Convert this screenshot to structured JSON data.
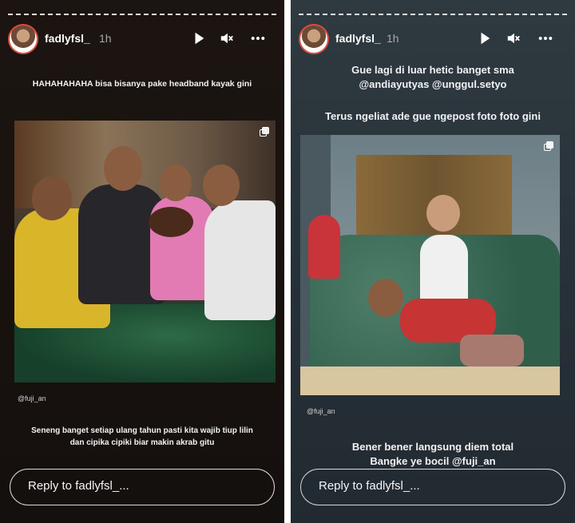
{
  "stories": [
    {
      "username": "fadlyfsl_",
      "time": "1h",
      "caption_top": "HAHAHAHAHA bisa bisanya pake headband kayak gini",
      "mention": "@fuji_an",
      "caption_bottom_1": "Seneng banget setiap ulang tahun pasti kita wajib tiup lilin",
      "caption_bottom_2": "dan cipika cipiki biar makin akrab gitu",
      "reply_placeholder": "Reply to fadlyfsl_..."
    },
    {
      "username": "fadlyfsl_",
      "time": "1h",
      "caption_1": "Gue lagi di luar hetic banget sma",
      "caption_2": "@andiayutyas @unggul.setyo",
      "caption_3": "Terus ngeliat ade gue ngepost foto foto gini",
      "mention": "@fuji_an",
      "caption_bottom_1": "Bener bener langsung diem total",
      "caption_bottom_2": "Bangke ye bocil @fuji_an",
      "reply_placeholder": "Reply to fadlyfsl_..."
    }
  ],
  "icons": {
    "play": "play-icon",
    "mute": "mute-icon",
    "more": "more-icon",
    "gallery": "multi-photo-icon"
  },
  "colors": {
    "left_bg": "#1a130f",
    "right_bg": "#28323a",
    "avatar_ring": "#e34c3f"
  }
}
